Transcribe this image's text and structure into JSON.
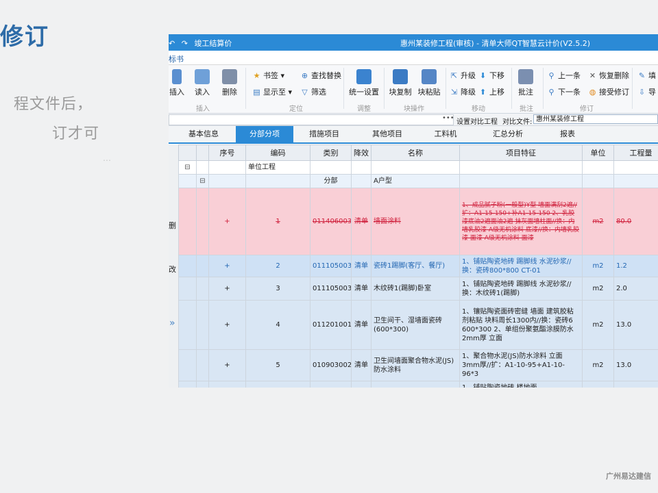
{
  "slide": {
    "title": "修订",
    "line1": "程文件后，",
    "line2": "订才可",
    "mark": "…",
    "footer": "广州易达建信"
  },
  "app": {
    "quick_access": [
      "↶",
      "↷",
      "竣工结算价"
    ],
    "window_title": "惠州某装修工程(审核) - 清单大师QT智慧云计价(V2.5.2)",
    "menu": "标书",
    "ribbon": {
      "buttons": [
        {
          "label": "插入",
          "icon": "insert-icon",
          "color": "#5a8fd0"
        },
        {
          "label": "读入",
          "icon": "read-icon",
          "color": "#6fa0d8"
        },
        {
          "label": "删除",
          "icon": "delete-icon",
          "color": "#7f8fa8"
        },
        {
          "label": "统一设置",
          "icon": "unified-settings-icon",
          "color": "#3b83cf"
        },
        {
          "label": "块复制",
          "icon": "block-copy-icon",
          "color": "#3b7bc4"
        },
        {
          "label": "块粘贴",
          "icon": "block-paste-icon",
          "color": "#5586c6"
        },
        {
          "label": "批注",
          "icon": "annotate-icon",
          "color": "#7b8fb0"
        }
      ],
      "small": {
        "bookmark": "书签",
        "find_replace": "查找替换",
        "show_to": "显示至",
        "filter": "筛选",
        "upgrade": "升级",
        "move_down": "下移",
        "downgrade": "降级",
        "move_up": "上移",
        "prev": "上一条",
        "restore_delete": "恢复删除",
        "next": "下一条",
        "accept_revision": "接受修订",
        "fill": "填",
        "import": "导"
      },
      "groups": [
        "插入",
        "定位",
        "调整",
        "块操作",
        "移动",
        "批注",
        "修订"
      ]
    },
    "compare": {
      "dots": "•••",
      "set_label": "设置对比工程",
      "file_label": "对比文件:",
      "file_value": "惠州某装修工程"
    },
    "tabs": [
      "基本信息",
      "分部分项",
      "措施项目",
      "其他项目",
      "工料机",
      "汇总分析",
      "报表"
    ],
    "active_tab": "分部分项",
    "left_marks": [
      "删",
      "改"
    ],
    "columns": [
      "序号",
      "编码",
      "类别",
      "降效",
      "名称",
      "项目特征",
      "单位",
      "工程量"
    ],
    "rows": [
      {
        "tree": "⊟",
        "seq": "",
        "code": "单位工程",
        "type": "",
        "name": "",
        "feature": "",
        "unit": "",
        "qty": ""
      },
      {
        "tree": "⊟",
        "seq": "",
        "code": "",
        "type": "分部",
        "name": "A户型",
        "feature": "",
        "unit": "",
        "qty": ""
      },
      {
        "tree": "+",
        "seq": "1",
        "code": "011406003001",
        "type": "清单",
        "name": "墙面涂料",
        "feature": "1、成品腻子粉(一般型)Y型 墙面满刮2遍//扩：A1-15-150+补A1-15-150 2、乳胶漆底油2遍面油2遍 抹灰面墙柱面//换：内墙乳胶漆 A级无机涂料 底漆//换：内墙乳胶漆 面漆 A级无机涂料 面漆",
        "unit": "m2",
        "qty": "80.0"
      },
      {
        "tree": "+",
        "seq": "2",
        "code": "011105003001",
        "type": "清单",
        "name": "瓷砖1踢脚(客厅、餐厅)",
        "feature": "1、铺贴陶瓷地砖 踢脚线 水泥砂浆//换：瓷砖800*800 CT-01",
        "unit": "m2",
        "qty": "1.2"
      },
      {
        "tree": "+",
        "seq": "3",
        "code": "011105003002",
        "type": "清单",
        "name": "木纹砖1(踢脚)卧室",
        "feature": "1、铺贴陶瓷地砖 踢脚线 水泥砂浆//换：木纹砖1(踢脚)",
        "unit": "m2",
        "qty": "2.0"
      },
      {
        "tree": "+",
        "seq": "4",
        "code": "011201001001",
        "type": "清单",
        "name": "卫生间干、湿墙面瓷砖(600*300)",
        "feature": "1、镶贴陶瓷面砖密缝 墙面 建筑胶粘剂粘贴 块料周长1300内//换：瓷砖6 600*300 2、单组份聚氨酯涂膜防水 2mm厚 立面",
        "unit": "m2",
        "qty": "13.0"
      },
      {
        "tree": "+",
        "seq": "5",
        "code": "010903002001",
        "type": "清单",
        "name": "卫生间墙面聚合物水泥(JS)防水涂料",
        "feature": "1、聚合物水泥(JS)防水涂料 立面 3mm厚//扩：A1-10-95+A1-10-96*3",
        "unit": "m2",
        "qty": "13.0"
      },
      {
        "tree": "",
        "seq": "",
        "code": "",
        "type": "",
        "name": "",
        "feature": "1、铺贴陶瓷地砖 楼地面",
        "unit": "",
        "qty": ""
      }
    ]
  }
}
